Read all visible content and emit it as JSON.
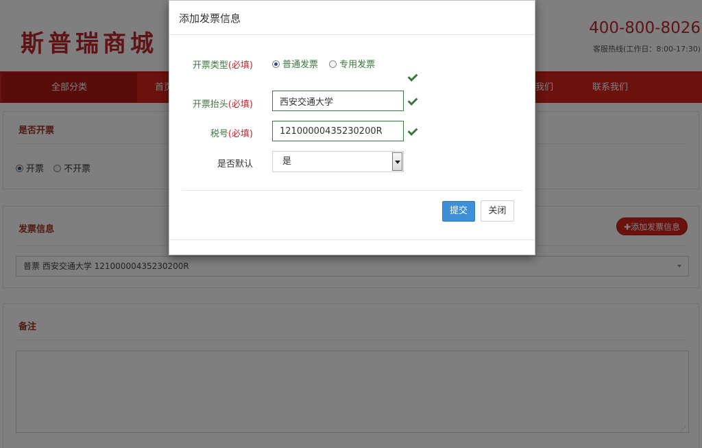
{
  "header": {
    "logo_text": "斯普瑞商城",
    "hotline_number": "400-800-8026",
    "hotline_label": "客服热线(工作日：8:00-17:30)"
  },
  "nav": {
    "all_categories": "全部分类",
    "home": "首页",
    "about": "关于我们",
    "contact": "联系我们"
  },
  "invoice_toggle": {
    "title": "是否开票",
    "option_yes": "开票",
    "option_no": "不开票",
    "selected": "开票"
  },
  "invoice_info": {
    "title": "发票信息",
    "add_button": "✚添加发票信息",
    "selected_invoice": "普票 西安交通大学 12100000435230200R"
  },
  "remarks": {
    "title": "备注",
    "value": ""
  },
  "modal": {
    "title": "添加发票信息",
    "required_mark": "(必填)",
    "type_label": "开票类型",
    "type_options": [
      "普通发票",
      "专用发票"
    ],
    "type_selected": "普通发票",
    "heading_label": "开票抬头",
    "heading_value": "西安交通大学",
    "tax_label": "税号",
    "tax_value": "12100000435230200R",
    "default_label": "是否默认",
    "default_value": "是",
    "submit_label": "提交",
    "close_label": "关闭"
  },
  "colors": {
    "brand_red": "#d6231d",
    "success_green": "#3c763d",
    "primary_blue": "#3d8fd6"
  }
}
